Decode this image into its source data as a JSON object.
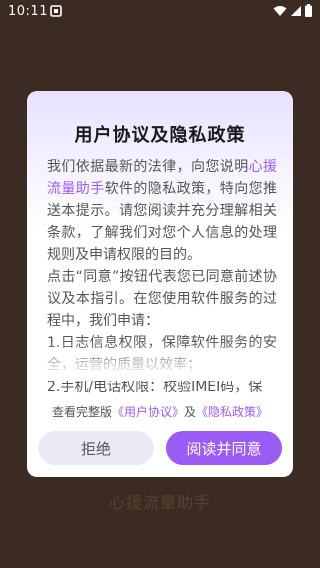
{
  "status_bar": {
    "time": "10:11",
    "notification_icon": "sim-card-icon",
    "wifi_icon": "wifi-icon",
    "signal_icon": "cellular-signal-icon",
    "battery_icon": "battery-icon"
  },
  "background": {
    "app_name": "心援流量助手"
  },
  "dialog": {
    "title": "用户协议及隐私政策",
    "body_intro_before": "我们依据最新的法律，向您说明",
    "body_app_name": "心援流量助手",
    "body_intro_after": "软件的隐私政策，特向您推送本提示。请您阅读并充分理解相关条款，了解我们对您个人信息的处理规则及申请权限的目的。",
    "body_paragraph_2": "点击“同意”按钮代表您已同意前述协议及本指引。在您使用软件服务的过程中，我们申请：",
    "body_item_1": "1.日志信息权限，保障软件服务的安全，运营的质量以效率；",
    "body_item_2": "2.手机/电话权限：校验IMEI码，保",
    "view_full_prefix": "查看完整版",
    "user_agreement_link": "《用户协议》",
    "and_text": "及",
    "privacy_policy_link": "《隐私政策》",
    "reject_label": "拒绝",
    "accept_label": "阅读并同意"
  },
  "colors": {
    "accent": "#9b5cf6",
    "backdrop": "#3b2b22"
  }
}
